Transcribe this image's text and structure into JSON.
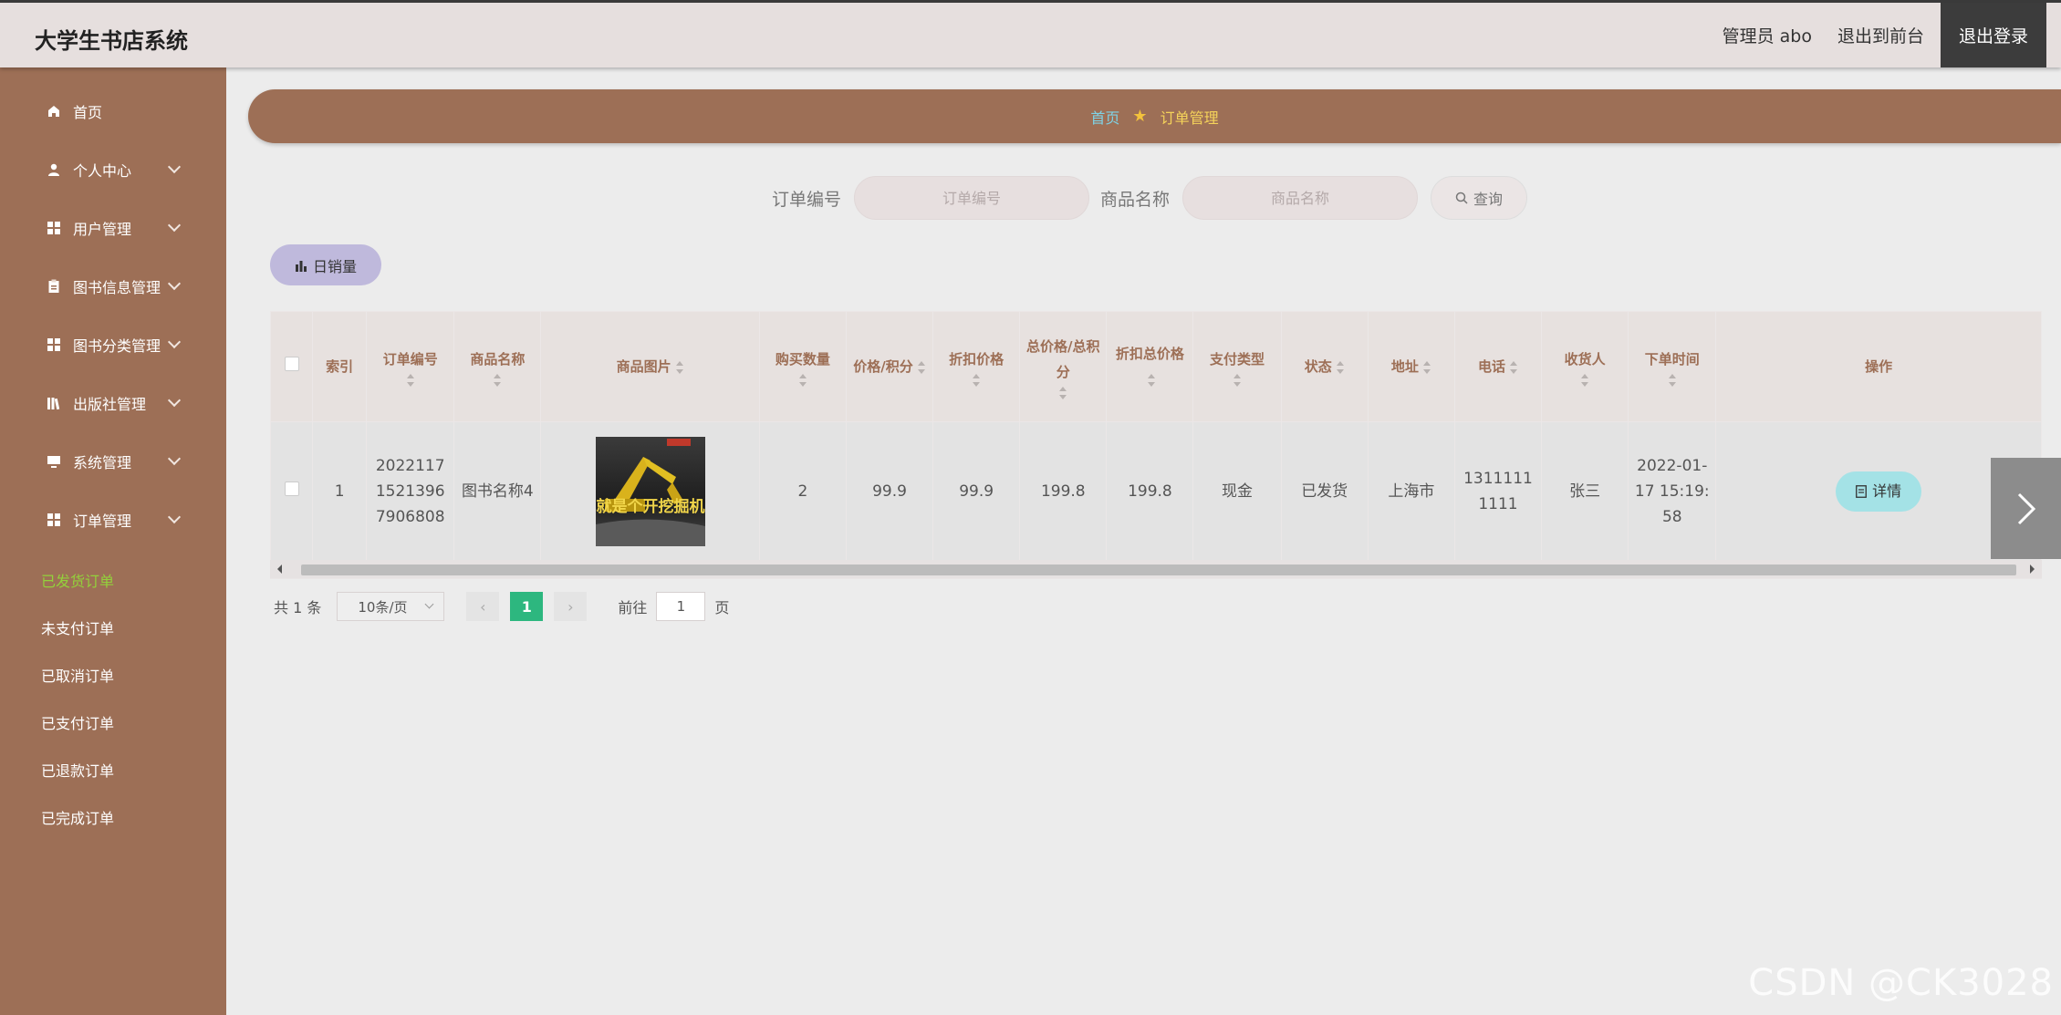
{
  "header": {
    "app_title": "大学生书店系统",
    "user": "管理员 abo",
    "to_front": "退出到前台",
    "logout": "退出登录"
  },
  "sidebar": {
    "items": [
      {
        "label": "首页",
        "icon": "home-icon"
      },
      {
        "label": "个人中心",
        "icon": "user-icon"
      },
      {
        "label": "用户管理",
        "icon": "grid-icon"
      },
      {
        "label": "图书信息管理",
        "icon": "clipboard-icon"
      },
      {
        "label": "图书分类管理",
        "icon": "grid-icon"
      },
      {
        "label": "出版社管理",
        "icon": "library-icon"
      },
      {
        "label": "系统管理",
        "icon": "monitor-icon"
      },
      {
        "label": "订单管理",
        "icon": "grid-icon"
      }
    ],
    "sub_items": [
      "已发货订单",
      "未支付订单",
      "已取消订单",
      "已支付订单",
      "已退款订单",
      "已完成订单"
    ],
    "active_sub": "已发货订单"
  },
  "breadcrumb": {
    "home": "首页",
    "current": "订单管理"
  },
  "search": {
    "order_label": "订单编号",
    "order_placeholder": "订单编号",
    "product_label": "商品名称",
    "product_placeholder": "商品名称",
    "query_button": "查询"
  },
  "toolbar": {
    "daily_sales": "日销量"
  },
  "table": {
    "headers": [
      "索引",
      "订单编号",
      "商品名称",
      "商品图片",
      "购买数量",
      "价格/积分",
      "折扣价格",
      "总价格/总积分",
      "折扣总价格",
      "支付类型",
      "状态",
      "地址",
      "电话",
      "收货人",
      "下单时间",
      "操作"
    ],
    "rows": [
      {
        "index": "1",
        "order_no": "20221171521396790680​8",
        "product_name": "图书名称4",
        "image_text": "我就是个开挖掘机的",
        "quantity": "2",
        "price": "99.9",
        "discount_price": "99.9",
        "total_price": "199.8",
        "discount_total": "199.8",
        "pay_type": "现金",
        "status": "已发货",
        "address": "上海市",
        "phone": "13111111111",
        "receiver": "张三",
        "order_time": "2022-01-17 15:19:58",
        "action": "详情"
      }
    ]
  },
  "pagination": {
    "total": "共 1 条",
    "page_size": "10条/页",
    "current_page": "1",
    "goto_prefix": "前往",
    "goto_value": "1",
    "goto_suffix": "页"
  },
  "watermark": "CSDN @CK3028",
  "colors": {
    "sidebar": "#9d6f56",
    "active_sub": "#93d13b",
    "page_active": "#2db77f",
    "detail_button": "#a4e2e6"
  }
}
